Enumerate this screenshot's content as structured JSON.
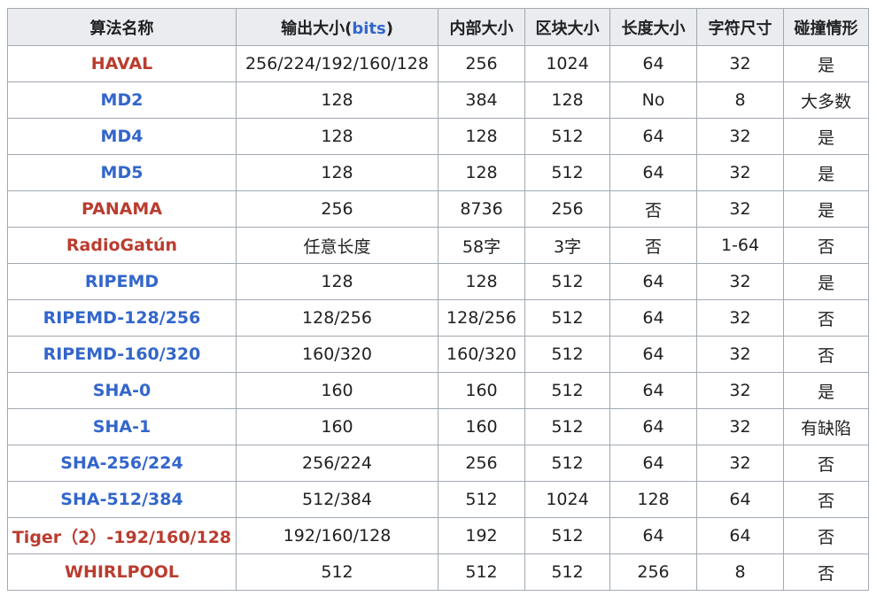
{
  "colors": {
    "link_blue": "#3366cc",
    "link_red": "#ba3c2f",
    "header_bg": "#eaecf0",
    "border": "#a2a9b1",
    "text": "#202122"
  },
  "table": {
    "headers": {
      "name": "算法名称",
      "output_prefix": "输出大小(",
      "output_link": "bits",
      "output_suffix": ")",
      "internal": "内部大小",
      "block": "区块大小",
      "length": "长度大小",
      "word": "字符尺寸",
      "collision": "碰撞情形"
    },
    "rows": [
      {
        "name": "HAVAL",
        "link": "red",
        "output": "256/224/192/160/128",
        "internal": "256",
        "block": "1024",
        "length": "64",
        "word": "32",
        "collision": "是"
      },
      {
        "name": "MD2",
        "link": "blue",
        "output": "128",
        "internal": "384",
        "block": "128",
        "length": "No",
        "word": "8",
        "collision": "大多数"
      },
      {
        "name": "MD4",
        "link": "blue",
        "output": "128",
        "internal": "128",
        "block": "512",
        "length": "64",
        "word": "32",
        "collision": "是"
      },
      {
        "name": "MD5",
        "link": "blue",
        "output": "128",
        "internal": "128",
        "block": "512",
        "length": "64",
        "word": "32",
        "collision": "是"
      },
      {
        "name": "PANAMA",
        "link": "red",
        "output": "256",
        "internal": "8736",
        "block": "256",
        "length": "否",
        "word": "32",
        "collision": "是"
      },
      {
        "name": "RadioGatún",
        "link": "red",
        "output": "任意长度",
        "internal": "58字",
        "block": "3字",
        "length": "否",
        "word": "1-64",
        "collision": "否"
      },
      {
        "name": "RIPEMD",
        "link": "blue",
        "output": "128",
        "internal": "128",
        "block": "512",
        "length": "64",
        "word": "32",
        "collision": "是"
      },
      {
        "name": "RIPEMD-128/256",
        "link": "blue",
        "output": "128/256",
        "internal": "128/256",
        "block": "512",
        "length": "64",
        "word": "32",
        "collision": "否"
      },
      {
        "name": "RIPEMD-160/320",
        "link": "blue",
        "output": "160/320",
        "internal": "160/320",
        "block": "512",
        "length": "64",
        "word": "32",
        "collision": "否"
      },
      {
        "name": "SHA-0",
        "link": "blue",
        "output": "160",
        "internal": "160",
        "block": "512",
        "length": "64",
        "word": "32",
        "collision": "是"
      },
      {
        "name": "SHA-1",
        "link": "blue",
        "output": "160",
        "internal": "160",
        "block": "512",
        "length": "64",
        "word": "32",
        "collision": "有缺陷"
      },
      {
        "name": "SHA-256/224",
        "link": "blue",
        "output": "256/224",
        "internal": "256",
        "block": "512",
        "length": "64",
        "word": "32",
        "collision": "否"
      },
      {
        "name": "SHA-512/384",
        "link": "blue",
        "output": "512/384",
        "internal": "512",
        "block": "1024",
        "length": "128",
        "word": "64",
        "collision": "否"
      },
      {
        "name": "Tiger（2）-192/160/128",
        "link": "red",
        "output": "192/160/128",
        "internal": "192",
        "block": "512",
        "length": "64",
        "word": "64",
        "collision": "否"
      },
      {
        "name": "WHIRLPOOL",
        "link": "red",
        "output": "512",
        "internal": "512",
        "block": "512",
        "length": "256",
        "word": "8",
        "collision": "否"
      }
    ]
  }
}
